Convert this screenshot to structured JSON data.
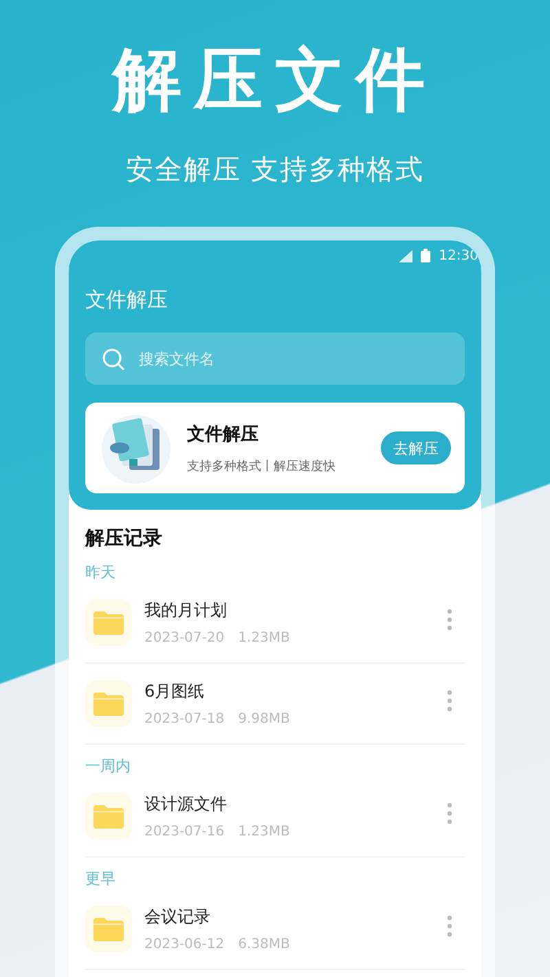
{
  "headline": "解压文件",
  "subtitle": "安全解压 支持多种格式",
  "status_bar": {
    "time": "12:30"
  },
  "app_title": "文件解压",
  "search": {
    "placeholder": "搜索文件名"
  },
  "feature_card": {
    "title": "文件解压",
    "description": "支持多种格式丨解压速度快",
    "button": "去解压"
  },
  "history": {
    "title": "解压记录",
    "sections": [
      {
        "label": "昨天",
        "files": [
          {
            "name": "我的月计划",
            "date": "2023-07-20",
            "size": "1.23MB"
          },
          {
            "name": "6月图纸",
            "date": "2023-07-18",
            "size": "9.98MB"
          }
        ]
      },
      {
        "label": "一周内",
        "files": [
          {
            "name": "设计源文件",
            "date": "2023-07-16",
            "size": "1.23MB"
          }
        ]
      },
      {
        "label": "更早",
        "files": [
          {
            "name": "会议记录",
            "date": "2023-06-12",
            "size": "6.38MB"
          }
        ]
      }
    ]
  }
}
